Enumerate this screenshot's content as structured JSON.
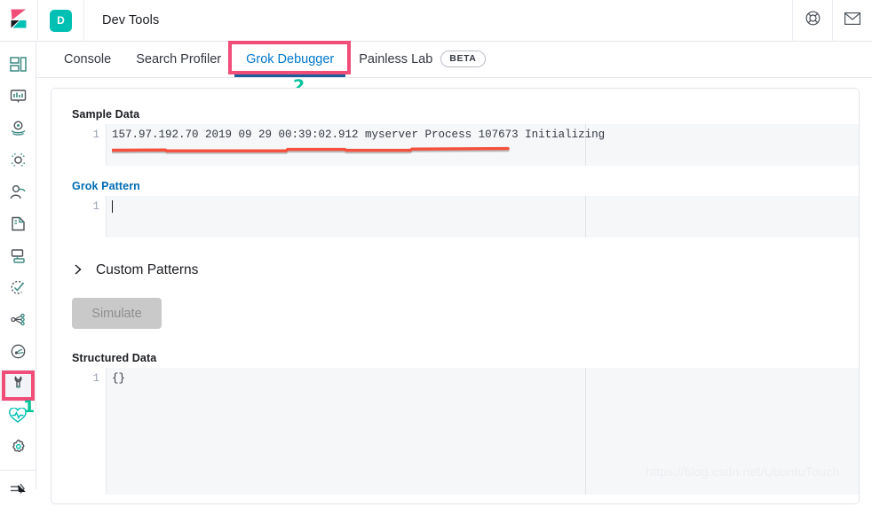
{
  "header": {
    "logo_icon": "kibana-logo-icon",
    "app_badge": "D",
    "title": "Dev Tools",
    "help_icon": "lifebuoy-help-icon",
    "mail_icon": "envelope-mail-icon",
    "brand_colors": {
      "pink": "#F04E78",
      "teal": "#00BFB3",
      "black": "#1a1c21"
    }
  },
  "sidebar": {
    "items": [
      {
        "name": "sidebar-item-dashboard",
        "icon": "dashboard-icon",
        "selected": false
      },
      {
        "name": "sidebar-item-canvas",
        "icon": "canvas-presentation-icon",
        "selected": false
      },
      {
        "name": "sidebar-item-maps",
        "icon": "map-pin-icon",
        "selected": false
      },
      {
        "name": "sidebar-item-graph",
        "icon": "graph-nodes-icon",
        "selected": false
      },
      {
        "name": "sidebar-item-machine-learning",
        "icon": "user-profile-icon",
        "selected": false
      },
      {
        "name": "sidebar-item-infrastructure",
        "icon": "infrastructure-icon",
        "selected": false
      },
      {
        "name": "sidebar-item-logs",
        "icon": "logs-stream-icon",
        "selected": false
      },
      {
        "name": "sidebar-item-uptime",
        "icon": "uptime-clock-icon",
        "selected": false
      },
      {
        "name": "sidebar-item-apm",
        "icon": "apm-nodes-icon",
        "selected": false
      },
      {
        "name": "sidebar-item-monitoring",
        "icon": "monitoring-signal-icon",
        "selected": false
      },
      {
        "name": "sidebar-item-dev-tools",
        "icon": "wrench-icon",
        "selected": true
      },
      {
        "name": "sidebar-item-stack-monitoring",
        "icon": "heartbeat-icon",
        "selected": false
      },
      {
        "name": "sidebar-item-management",
        "icon": "gear-icon",
        "selected": false
      },
      {
        "name": "sidebar-item-collapse",
        "icon": "arrow-collapse-icon",
        "selected": false
      }
    ],
    "highlight_color": "#F04E78"
  },
  "annotations": {
    "one": "1",
    "two": "2",
    "color": "#00C39A",
    "underline_color": "#F4503C"
  },
  "tabs": [
    {
      "label": "Console",
      "active": false,
      "badge": ""
    },
    {
      "label": "Search Profiler",
      "active": false,
      "badge": ""
    },
    {
      "label": "Grok Debugger",
      "active": true,
      "badge": ""
    },
    {
      "label": "Painless Lab",
      "active": false,
      "badge": "BETA"
    }
  ],
  "main": {
    "sample_data": {
      "label": "Sample Data",
      "line_number": "1",
      "value": "157.97.192.70 2019 09 29 00:39:02.912 myserver Process 107673 Initializing"
    },
    "grok_pattern": {
      "label": "Grok Pattern",
      "line_number": "1",
      "value": "",
      "placeholder": ""
    },
    "custom_patterns": {
      "label": "Custom Patterns",
      "chevron_icon": "chevron-right-icon",
      "expanded": false
    },
    "simulate_button": {
      "label": "Simulate",
      "disabled": true
    },
    "structured_data": {
      "label": "Structured Data",
      "line_number": "1",
      "value": "{}"
    }
  },
  "watermark": "https://blog.csdn.net/UbuntuTouch"
}
